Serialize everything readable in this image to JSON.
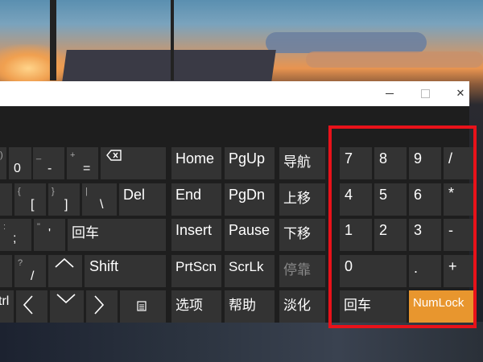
{
  "window": {
    "controls": {
      "minimize": "—",
      "maximize": "□",
      "close": "✕"
    }
  },
  "keys": {
    "paren_close": ")",
    "zero": "0",
    "underscore": "_",
    "minus": "-",
    "plus": "+",
    "equals": "=",
    "backspace_icon": "backspace-icon",
    "brace_open": "{",
    "bracket_open": "[",
    "brace_close": "}",
    "bracket_close": "]",
    "pipe": "|",
    "backslash": "\\",
    "del": "Del",
    "colon": ":",
    "semicolon": ";",
    "quote": "\"",
    "apostrophe": "'",
    "enter_left": "回车",
    "question": "?",
    "slash": "/",
    "shift": "Shift",
    "ctrl_partial": "trl",
    "home": "Home",
    "pgup": "PgUp",
    "nav": "导航",
    "end": "End",
    "pgdn": "PgDn",
    "move_up": "上移",
    "insert": "Insert",
    "pause": "Pause",
    "move_down": "下移",
    "prtscn": "PrtScn",
    "scrlk": "ScrLk",
    "dock": "停靠",
    "options": "选项",
    "help": "帮助",
    "fade": "淡化"
  },
  "numpad": {
    "row1": [
      "7",
      "8",
      "9",
      "/"
    ],
    "row2": [
      "4",
      "5",
      "6",
      "*"
    ],
    "row3": [
      "1",
      "2",
      "3",
      "-"
    ],
    "zero": "0",
    "dot": ".",
    "plus": "+",
    "enter": "回车",
    "numlock": "NumLock"
  },
  "colors": {
    "key_bg": "#333333",
    "window_bg": "#1e1e1e",
    "accent": "#e8962e",
    "highlight": "#e8121a"
  }
}
